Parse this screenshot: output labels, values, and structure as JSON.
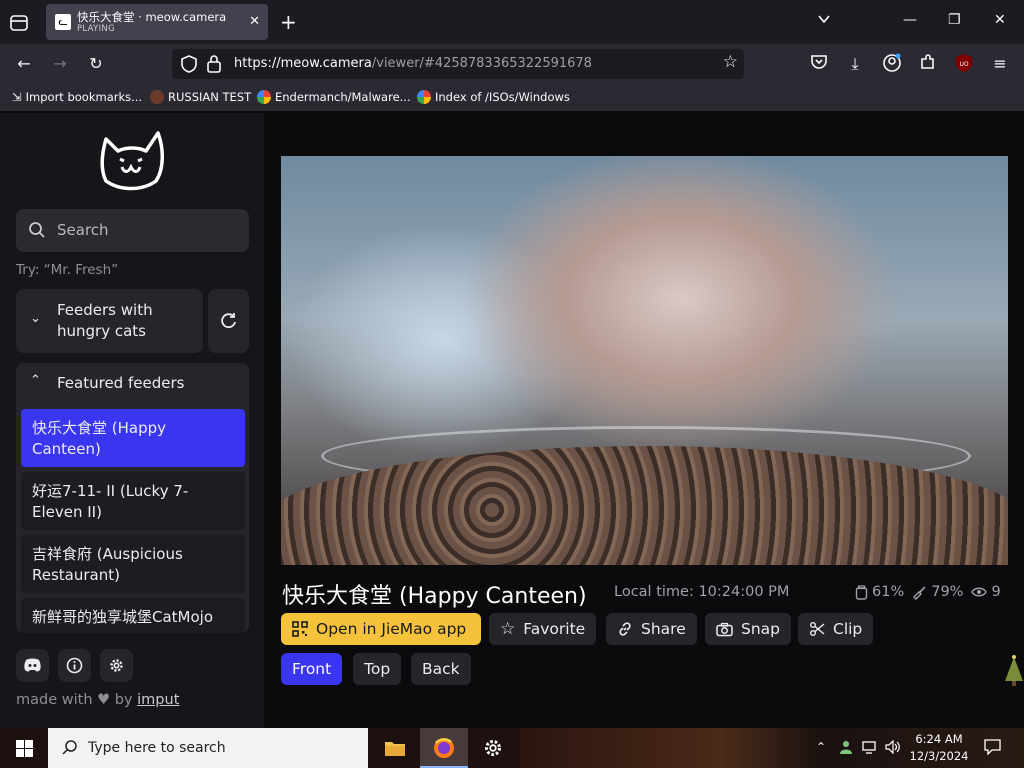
{
  "browser": {
    "tab": {
      "title": "快乐大食堂 · meow.camera",
      "status": "PLAYING"
    },
    "url_host": "https://meow.camera",
    "url_path": "/viewer/#4258783365322591678",
    "bookmarks": [
      "Import bookmarks...",
      "RUSSIAN TEST",
      "Endermanch/Malware...",
      "Index of /ISOs/Windows"
    ]
  },
  "sidebar": {
    "search_placeholder": "Search",
    "hint": "Try: “Mr. Fresh”",
    "hungry_label": "Feeders with hungry cats",
    "featured_label": "Featured feeders",
    "feeders": [
      "快乐大食堂 (Happy Canteen)",
      "好运7-11- II (Lucky 7-Eleven II)",
      "吉祥食府 (Auspicious Restaurant)",
      "新鲜哥的独享城堡CatMojo"
    ],
    "made_with": "made with",
    "made_by": "by",
    "made_link": "imput"
  },
  "viewer": {
    "title": "快乐大食堂 (Happy Canteen)",
    "local_time": "Local time: 10:24:00 PM",
    "stats": {
      "food": "61%",
      "clean": "79%",
      "viewers": "9"
    },
    "actions": {
      "open_app": "Open in JieMao app",
      "favorite": "Favorite",
      "share": "Share",
      "snap": "Snap",
      "clip": "Clip"
    },
    "cameras": [
      "Front",
      "Top",
      "Back"
    ]
  },
  "taskbar": {
    "search_placeholder": "Type here to search",
    "time": "6:24 AM",
    "date": "12/3/2024"
  },
  "colors": {
    "accent": "#3a36f0",
    "app_button": "#f5c33b",
    "panel": "#25252b"
  }
}
